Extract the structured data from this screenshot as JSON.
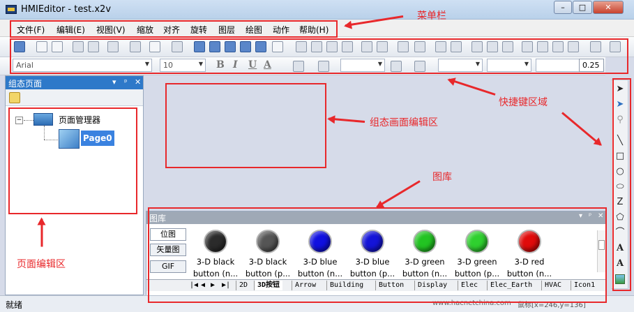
{
  "window": {
    "title": "HMIEditor - test.x2v",
    "minimize": "–",
    "maximize": "□",
    "close": "✕"
  },
  "menu": [
    "文件(F)",
    "编辑(E)",
    "视图(V)",
    "缩放",
    "对齐",
    "旋转",
    "图层",
    "绘图",
    "动作",
    "帮助(H)"
  ],
  "format_bar": {
    "font": "Arial",
    "size": "10",
    "bold": "B",
    "italic": "I",
    "underline": "U",
    "color_a": "A",
    "line_width": "0.25"
  },
  "left_panel": {
    "title": "组态页面",
    "tree_root": "页面管理器",
    "tree_child": "Page0",
    "pin": "▾ ᵖ ✕"
  },
  "gallery": {
    "title": "图库",
    "pin": "▾ ᵖ ✕",
    "side_tabs": [
      "位图",
      "矢量图",
      "GIF"
    ],
    "items": [
      {
        "line1": "3-D black",
        "line2": "button (n...",
        "color": "#2b2b2b"
      },
      {
        "line1": "3-D black",
        "line2": "button (p...",
        "color": "#555555"
      },
      {
        "line1": "3-D blue",
        "line2": "button (n...",
        "color": "#1010e0"
      },
      {
        "line1": "3-D blue",
        "line2": "button (p...",
        "color": "#1414d8"
      },
      {
        "line1": "3-D green",
        "line2": "button (n...",
        "color": "#22c422"
      },
      {
        "line1": "3-D green",
        "line2": "button (p...",
        "color": "#2fd02f"
      },
      {
        "line1": "3-D red",
        "line2": "button (n...",
        "color": "#e00b0b"
      }
    ],
    "nav": [
      "|◀",
      "◀",
      "▶",
      "▶|"
    ],
    "tabs": [
      "2D",
      "3D按钮",
      "Arrow",
      "Building",
      "Button",
      "Display",
      "Elec",
      "Elec_Earth",
      "HVAC",
      "Icon1"
    ]
  },
  "status": {
    "text": "就绪",
    "url": "www.hacnetchina.com",
    "coords": "鼠标[x=246,y=136]"
  },
  "annotations": {
    "menubar": "菜单栏",
    "shortcut": "快捷键区域",
    "canvas": "组态画面编辑区",
    "gallery": "图库",
    "page_editor": "页面编辑区"
  },
  "accent_color": "#e8282b",
  "title_blue": "#2e79c9"
}
